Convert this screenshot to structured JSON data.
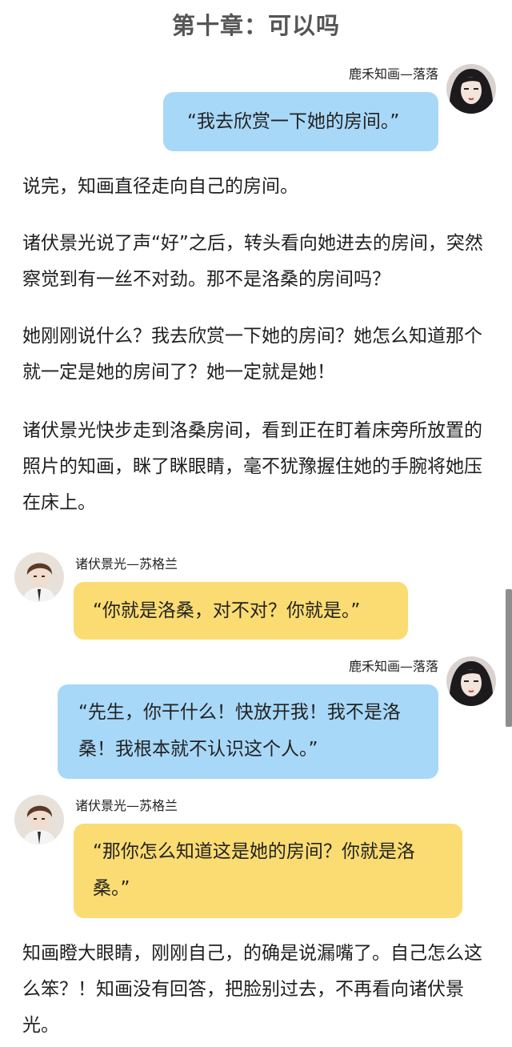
{
  "chapter_title": "第十章：可以吗",
  "characters": {
    "zhihua": {
      "name": "鹿禾知画—落落",
      "avatar_icon": "female-dark-hair-avatar-icon"
    },
    "zhufu": {
      "name": "诸伏景光—苏格兰",
      "avatar_icon": "male-brown-hair-avatar-icon"
    }
  },
  "messages": [
    {
      "speaker": "鹿禾知画—落落",
      "text": "“我去欣赏一下她的房间。”",
      "bubble_color": "#a8d8f8"
    },
    {
      "speaker": "诸伏景光—苏格兰",
      "text": "“你就是洛桑，对不对？你就是。”",
      "bubble_color": "#fbdc72"
    },
    {
      "speaker": "鹿禾知画—落落",
      "text": "“先生，你干什么！快放开我！我不是洛桑！我根本就不认识这个人。”",
      "bubble_color": "#a8d8f8"
    },
    {
      "speaker": "诸伏景光—苏格兰",
      "text": "“那你怎么知道这是她的房间？你就是洛桑。”",
      "bubble_color": "#fbdc72"
    }
  ],
  "paragraphs": [
    "说完，知画直径走向自己的房间。",
    "诸伏景光说了声“好”之后，转头看向她进去的房间，突然察觉到有一丝不对劲。那不是洛桑的房间吗？",
    "她刚刚说什么？我去欣赏一下她的房间？她怎么知道那个就一定是她的房间了？她一定就是她！",
    "诸伏景光快步走到洛桑房间，看到正在盯着床旁所放置的照片的知画，眯了眯眼睛，毫不犹豫握住她的手腕将她压在床上。",
    "知画瞪大眼睛，刚刚自己，的确是说漏嘴了。自己怎么这么笨？！知画没有回答，把脸别过去，不再看向诸伏景光。"
  ]
}
